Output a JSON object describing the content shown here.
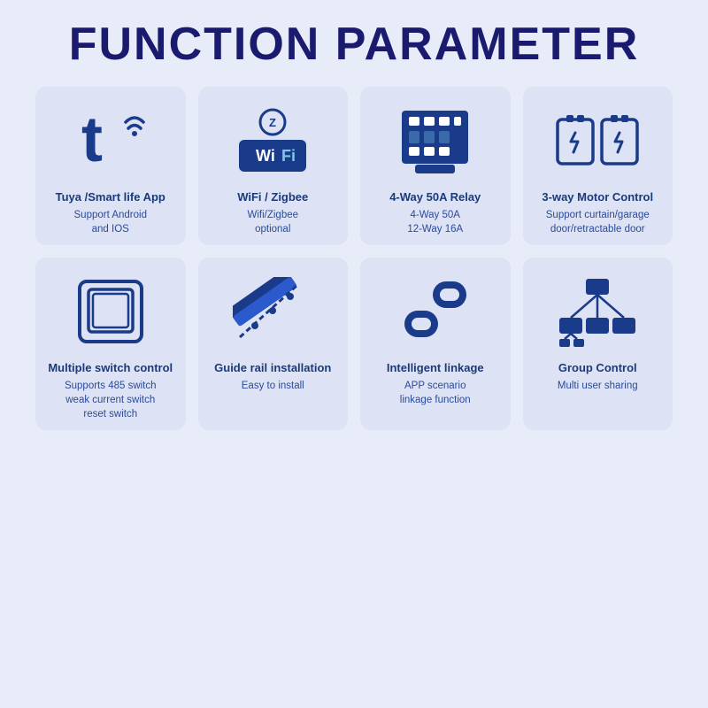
{
  "page": {
    "title": "FUNCTION PARAMETER",
    "background": "#e8ecf8"
  },
  "cards": [
    {
      "id": "tuya",
      "title": "Tuya /Smart life App",
      "subtitle": "Support Android\nand IOS",
      "icon": "tuya"
    },
    {
      "id": "wifi",
      "title": "WiFi / Zigbee",
      "subtitle": "Wifi/Zigbee\noptional",
      "icon": "wifi"
    },
    {
      "id": "relay",
      "title": "4-Way 50A Relay",
      "subtitle": "4-Way 50A\n12-Way 16A",
      "icon": "relay"
    },
    {
      "id": "motor",
      "title": "3-way Motor Control",
      "subtitle": "Support curtain/garage\ndoor/retractable door",
      "icon": "motor"
    },
    {
      "id": "switch",
      "title": "Multiple switch control",
      "subtitle": "Supports 485 switch\nweak current switch\nreset switch",
      "icon": "switch"
    },
    {
      "id": "rail",
      "title": "Guide rail installation",
      "subtitle": "Easy to install",
      "icon": "rail"
    },
    {
      "id": "linkage",
      "title": "Intelligent linkage",
      "subtitle": "APP scenario\nlinkage function",
      "icon": "linkage"
    },
    {
      "id": "group",
      "title": "Group Control",
      "subtitle": "Multi user sharing",
      "icon": "group"
    }
  ]
}
